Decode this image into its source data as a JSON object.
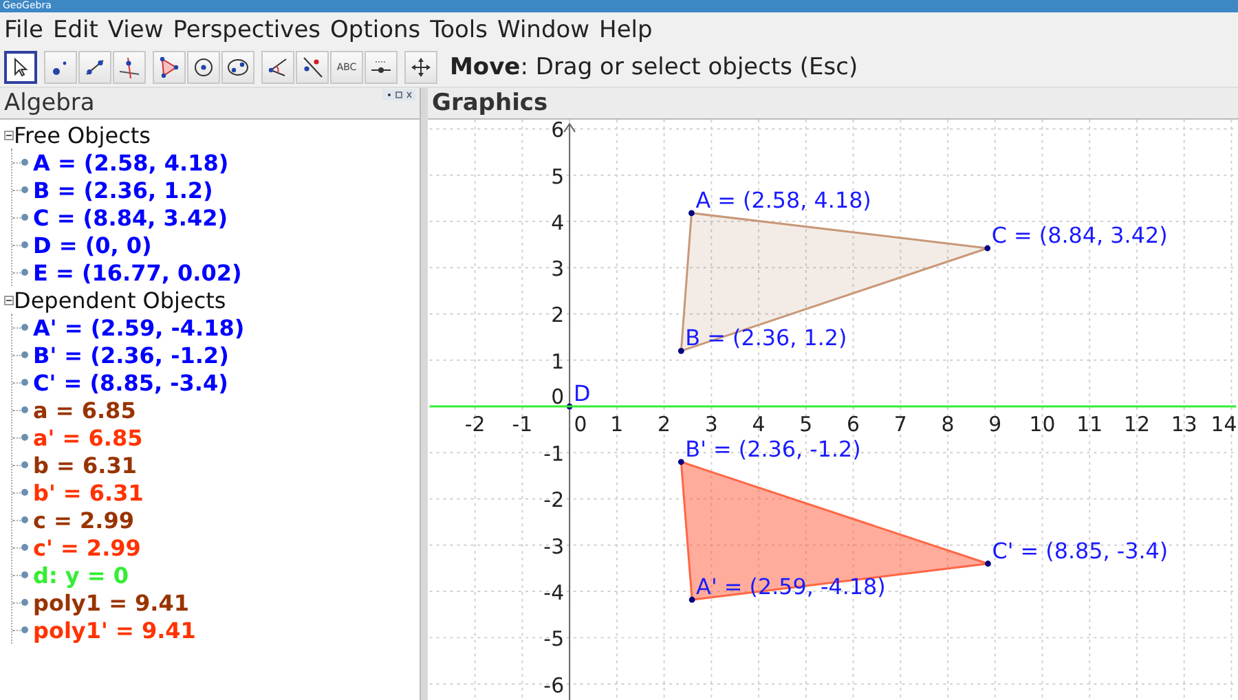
{
  "window": {
    "title": "GeoGebra"
  },
  "menu": [
    "File",
    "Edit",
    "View",
    "Perspectives",
    "Options",
    "Tools",
    "Window",
    "Help"
  ],
  "toolbar": {
    "tools": [
      {
        "kind": "move",
        "selected": true
      },
      {
        "kind": "point",
        "selected": false
      },
      {
        "kind": "line",
        "selected": false
      },
      {
        "kind": "perpendicular",
        "selected": false
      },
      {
        "kind": "polygon",
        "selected": false
      },
      {
        "kind": "circle",
        "selected": false
      },
      {
        "kind": "ellipse",
        "selected": false
      },
      {
        "kind": "angle",
        "selected": false
      },
      {
        "kind": "reflect",
        "selected": false
      },
      {
        "kind": "text",
        "selected": false,
        "label": "ABC"
      },
      {
        "kind": "slider",
        "selected": false
      },
      {
        "kind": "pan",
        "selected": false
      }
    ],
    "hint": "**Move**: Drag or select objects (Esc)"
  },
  "algebra": {
    "title": "Algebra",
    "groups": [
      {
        "label": "Free Objects",
        "expanded": true,
        "children": [
          {
            "text": "A = (2.58, 4.18)",
            "color": "#0000ff"
          },
          {
            "text": "B = (2.36, 1.2)",
            "color": "#0000ff"
          },
          {
            "text": "C = (8.84, 3.42)",
            "color": "#0000ff"
          },
          {
            "text": "D = (0, 0)",
            "color": "#0000ff"
          },
          {
            "text": "E = (16.77, 0.02)",
            "color": "#0000ff"
          }
        ]
      },
      {
        "label": "Dependent Objects",
        "expanded": true,
        "children": [
          {
            "text": "A' = (2.59, -4.18)",
            "color": "#0000ff"
          },
          {
            "text": "B' = (2.36, -1.2)",
            "color": "#0000ff"
          },
          {
            "text": "C' = (8.85, -3.4)",
            "color": "#0000ff"
          },
          {
            "text": "a = 6.85",
            "color": "#993300"
          },
          {
            "text": "a' = 6.85",
            "color": "#ff3300"
          },
          {
            "text": "b = 6.31",
            "color": "#993300"
          },
          {
            "text": "b' = 6.31",
            "color": "#ff3300"
          },
          {
            "text": "c = 2.99",
            "color": "#993300"
          },
          {
            "text": "c' = 2.99",
            "color": "#ff3300"
          },
          {
            "text": "d: y = 0",
            "color": "#33ee33"
          },
          {
            "text": "poly1 = 9.41",
            "color": "#993300"
          },
          {
            "text": "poly1' = 9.41",
            "color": "#ff3300"
          }
        ]
      }
    ]
  },
  "graphics": {
    "title": "Graphics",
    "y_tick_labels": [
      "6",
      "5",
      "4",
      "3",
      "2",
      "1",
      "0"
    ],
    "point_labels": [
      "A = (2.58, 4.18)",
      "C = (8.84, 3.42)",
      "B = (2.36, 1.2)",
      "D"
    ],
    "x_tick_labels": [
      "-2",
      "-1",
      "0",
      "1",
      "2",
      "3",
      "4",
      "5",
      "6",
      "7",
      "8",
      "9",
      "10",
      "11",
      "12",
      "13",
      "14"
    ],
    "lower_y_tick_labels": [
      "-1",
      "-2",
      "-3",
      "-4",
      "-5",
      "-6"
    ],
    "lower_point_labels": [
      "B' = (2.36, -1.2)",
      "C' = (8.85, -3.4)",
      "A' = (2.59, -4.18)"
    ]
  }
}
